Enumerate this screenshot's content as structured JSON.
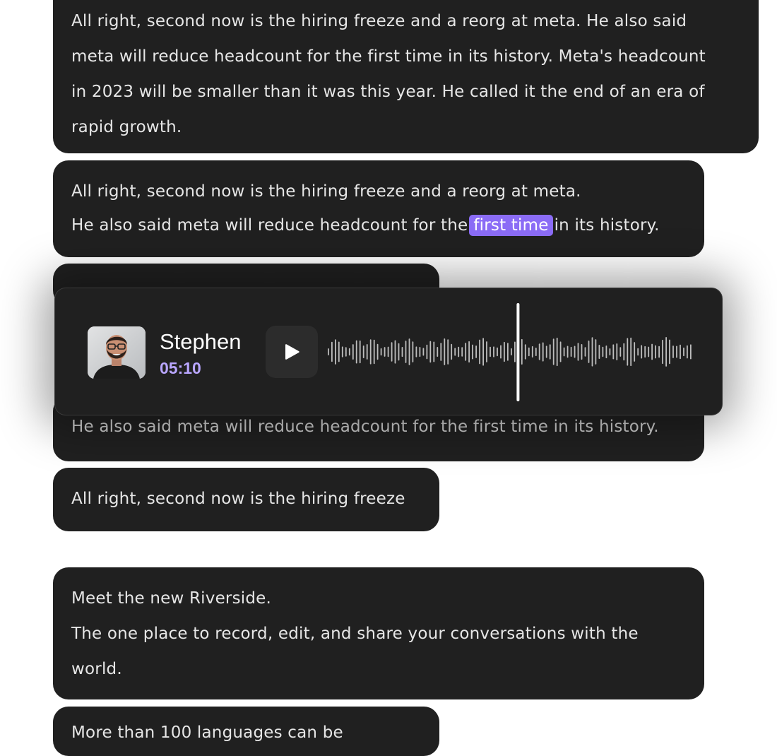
{
  "transcript": {
    "block1": [
      "All right, second now is the hiring freeze and a reorg at meta. He also said",
      "meta will reduce headcount for the first time in its history. Meta's headcount",
      "in 2023 will be smaller than it was this year. He called it the end of an era of",
      "rapid growth."
    ],
    "block2_line1": "All right, second now is the hiring freeze and a reorg at meta.",
    "block2_line2_before": "He also said meta will reduce headcount for the",
    "block2_highlight": "first time",
    "block2_line2_after": "in its history.",
    "block4_line": "He also said meta will reduce headcount for the first time in its history.",
    "block5_line": "All right, second now is the hiring freeze",
    "block6": [
      "Meet the new Riverside.",
      "The one place to record, edit, and share your conversations with the",
      "world."
    ],
    "block7_line": "More than 100 languages can be"
  },
  "player": {
    "speaker_name": "Stephen",
    "timestamp": "05:10",
    "play_icon": "play-icon",
    "avatar_icon": "speaker-photo",
    "played_fraction": 0.52
  },
  "colors": {
    "bubble_bg": "#202020",
    "highlight": "#8b6cf6",
    "timestamp": "#b9a6ff"
  }
}
